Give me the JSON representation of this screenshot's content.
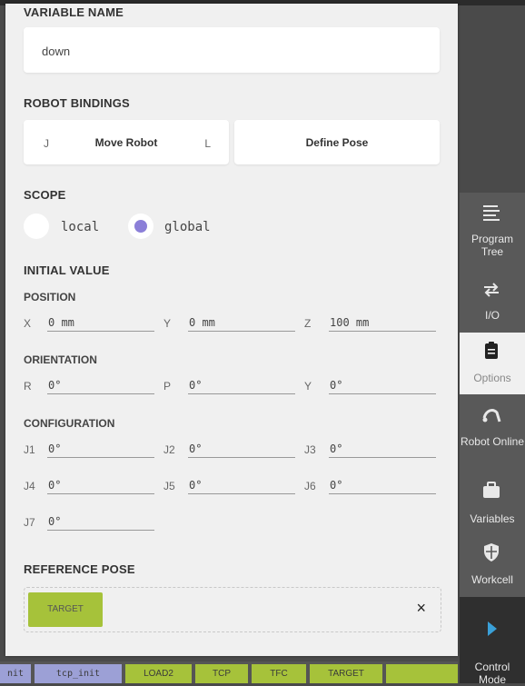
{
  "variable_name": {
    "label": "VARIABLE NAME",
    "value": "down"
  },
  "robot_bindings": {
    "label": "ROBOT BINDINGS",
    "j_key": "J",
    "move_robot": "Move Robot",
    "l_key": "L",
    "define_pose": "Define Pose"
  },
  "scope": {
    "label": "SCOPE",
    "options": [
      "local",
      "global"
    ],
    "selected": "global",
    "accent": "#8b7fd8"
  },
  "initial_value": {
    "label": "INITIAL VALUE",
    "position": {
      "label": "POSITION",
      "fields": [
        {
          "axis": "X",
          "value": "0 mm"
        },
        {
          "axis": "Y",
          "value": "0 mm"
        },
        {
          "axis": "Z",
          "value": "100 mm"
        }
      ]
    },
    "orientation": {
      "label": "ORIENTATION",
      "fields": [
        {
          "axis": "R",
          "value": "0°"
        },
        {
          "axis": "P",
          "value": "0°"
        },
        {
          "axis": "Y",
          "value": "0°"
        }
      ]
    },
    "configuration": {
      "label": "CONFIGURATION",
      "fields": [
        {
          "axis": "J1",
          "value": "0°"
        },
        {
          "axis": "J2",
          "value": "0°"
        },
        {
          "axis": "J3",
          "value": "0°"
        },
        {
          "axis": "J4",
          "value": "0°"
        },
        {
          "axis": "J5",
          "value": "0°"
        },
        {
          "axis": "J6",
          "value": "0°"
        },
        {
          "axis": "J7",
          "value": "0°"
        }
      ]
    }
  },
  "reference_pose": {
    "label": "REFERENCE POSE",
    "chip": "TARGET",
    "close": "×"
  },
  "sidebar": [
    {
      "label": "Program Tree",
      "icon": "list-icon"
    },
    {
      "label": "I/O",
      "icon": "io-arrows-icon"
    },
    {
      "label": "Options",
      "icon": "clipboard-icon",
      "active": true
    },
    {
      "label": "Robot Online",
      "icon": "robot-arm-icon"
    },
    {
      "label": "Variables",
      "icon": "briefcase-icon"
    },
    {
      "label": "Workcell",
      "icon": "shield-icon"
    },
    {
      "label": "Control Mode",
      "icon": "play-icon"
    }
  ],
  "bottom_chips": [
    {
      "label": "nit",
      "color": "#9ca0d6"
    },
    {
      "label": "tcp_init",
      "color": "#9ca0d6"
    },
    {
      "label": "LOAD2",
      "color": "#a6c23a"
    },
    {
      "label": "TCP",
      "color": "#a6c23a"
    },
    {
      "label": "TFC",
      "color": "#a6c23a"
    },
    {
      "label": "TARGET",
      "color": "#a6c23a"
    },
    {
      "label": "",
      "color": "#a6c23a"
    }
  ]
}
